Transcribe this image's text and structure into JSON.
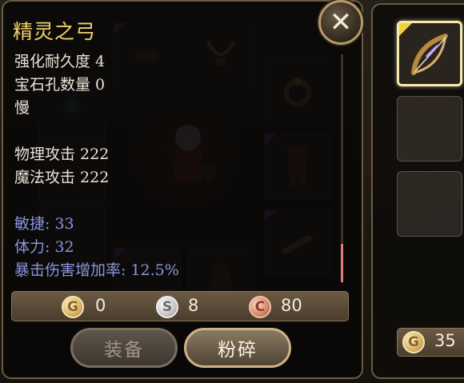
{
  "tooltip": {
    "item_name": "精灵之弓",
    "stats_basic": [
      "强化耐久度 4",
      "宝石孔数量 0",
      "慢"
    ],
    "stats_attack": [
      "物理攻击 222",
      "魔法攻击 222"
    ],
    "stats_bonus": [
      "敏捷: 33",
      "体力: 32",
      "暴击伤害增加率: 12.5%"
    ],
    "price": {
      "gold": {
        "icon_letter": "G",
        "value": "0"
      },
      "silver": {
        "icon_letter": "S",
        "value": "8"
      },
      "copper": {
        "icon_letter": "C",
        "value": "80"
      }
    },
    "buttons": {
      "equip": "装备",
      "smash": "粉碎"
    },
    "scroll_position": 0.85
  },
  "side_panel": {
    "gold": {
      "icon_letter": "G",
      "value": "35"
    }
  },
  "colors": {
    "item_name": "#f0d36a",
    "bonus_stat": "#8a95e0",
    "panel_border": "#6d5a3e"
  },
  "icons": [
    "close-icon",
    "gold-coin-icon",
    "silver-coin-icon",
    "copper-coin-icon",
    "bow-icon"
  ]
}
